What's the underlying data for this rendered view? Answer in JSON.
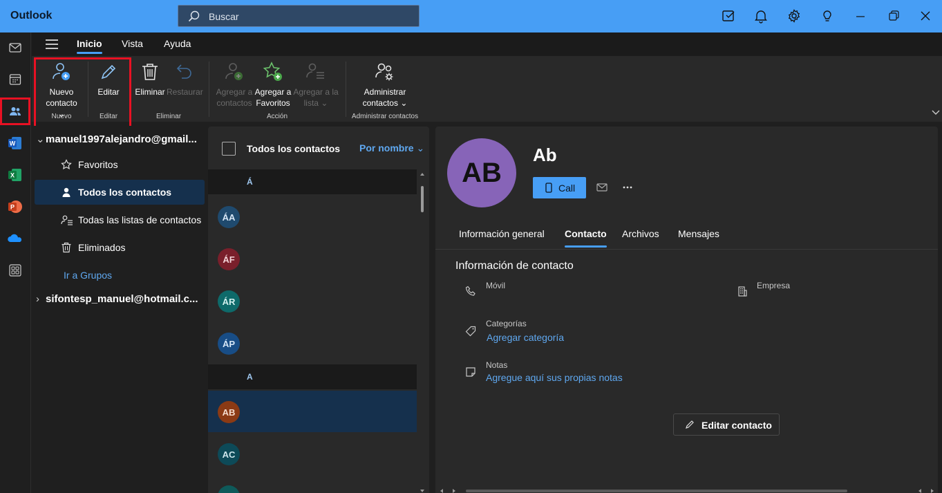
{
  "titlebar": {
    "app_title": "Outlook",
    "search_placeholder": "Buscar",
    "icons": [
      "notes-icon",
      "bell-icon",
      "gear-icon",
      "lightbulb-icon",
      "minimize-icon",
      "restore-icon",
      "close-icon"
    ]
  },
  "rail": {
    "items": [
      "mail",
      "calendar",
      "people",
      "word",
      "excel",
      "powerpoint",
      "onedrive",
      "apps"
    ],
    "active": "people"
  },
  "ribbon": {
    "tabs": [
      "Inicio",
      "Vista",
      "Ayuda"
    ],
    "active_tab": "Inicio",
    "buttons": {
      "new_contact": [
        "Nuevo",
        "contacto"
      ],
      "edit": "Editar",
      "delete": "Eliminar",
      "restore": "Restaurar",
      "add_to_contacts": [
        "Agregar a",
        "contactos"
      ],
      "add_to_favorites": [
        "Agregar a",
        "Favoritos"
      ],
      "add_to_list": [
        "Agregar a la",
        "lista"
      ],
      "manage": [
        "Administrar",
        "contactos"
      ]
    },
    "groups": {
      "nuevo": "Nuevo",
      "editar": "Editar",
      "eliminar": "Eliminar",
      "accion": "Acción",
      "administrar": "Administrar contactos"
    }
  },
  "folders": {
    "account1": "manuel1997alejandro@gmail...",
    "items": [
      {
        "label": "Favoritos"
      },
      {
        "label": "Todos los contactos"
      },
      {
        "label": "Todas las listas de contactos"
      },
      {
        "label": "Eliminados"
      }
    ],
    "groups_link": "Ir a Grupos",
    "account2": "sifontesp_manuel@hotmail.c..."
  },
  "contact_list": {
    "title": "Todos los contactos",
    "sort_label": "Por nombre",
    "section1": "Á",
    "section2": "A",
    "contacts": [
      {
        "initials": "ÁA",
        "color": "#1f4a6e",
        "text": "#d6e6f5"
      },
      {
        "initials": "ÁF",
        "color": "#7a1f2b",
        "text": "#f3d3d7"
      },
      {
        "initials": "ÁR",
        "color": "#0e6a6a",
        "text": "#d2f0ee"
      },
      {
        "initials": "ÁP",
        "color": "#184d86",
        "text": "#d5e6f7"
      },
      {
        "initials": "AB",
        "color": "#8b3a14",
        "text": "#f6dccd"
      },
      {
        "initials": "AC",
        "color": "#0d4a58",
        "text": "#cde6ec"
      }
    ]
  },
  "detail": {
    "initials": "AB",
    "name": "Ab",
    "call_label": "Call",
    "tabs": [
      "Información general",
      "Contacto",
      "Archivos",
      "Mensajes"
    ],
    "active_tab": "Contacto",
    "section_title": "Información de contacto",
    "mobile_label": "Móvil",
    "company_label": "Empresa",
    "categories_label": "Categorías",
    "categories_value": "Agregar categoría",
    "notes_label": "Notas",
    "notes_value": "Agregue aquí sus propias notas",
    "edit_button": "Editar contacto"
  }
}
